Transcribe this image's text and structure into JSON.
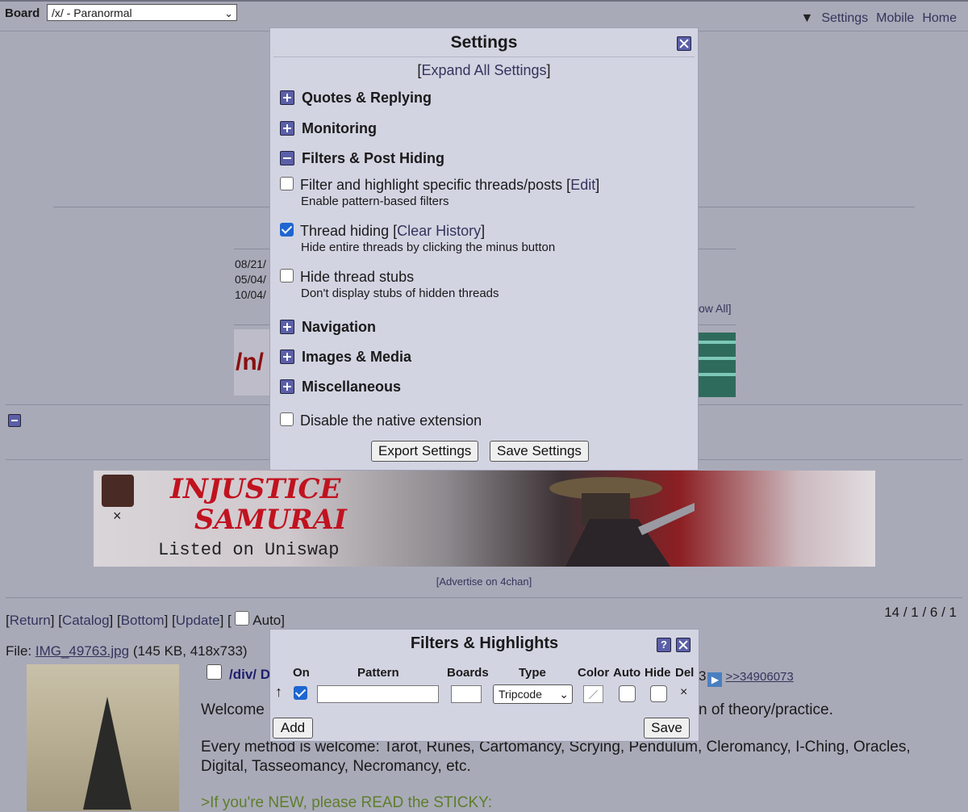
{
  "topbar": {
    "board_label": "Board",
    "board_value": "/x/ - Paranormal",
    "settings_arrow": "▼",
    "settings": "Settings",
    "mobile": "Mobile",
    "home": "Home"
  },
  "background": {
    "dates": [
      "08/21/",
      "05/04/",
      "10/04/"
    ],
    "show_all": "ow All]",
    "banner_text": "/n/"
  },
  "ad": {
    "title_line1": "INJUSTICE",
    "title_line2": "SAMURAI",
    "subtitle": "Listed on Uniswap",
    "close": "×",
    "advertise": "[Advertise on 4chan]"
  },
  "thread": {
    "nav": {
      "return": "Return",
      "catalog": "Catalog",
      "bottom": "Bottom",
      "update": "Update",
      "auto": "Auto"
    },
    "stats": "14 / 1 / 6 / 1",
    "file_prefix": "File: ",
    "file_name": "IMG_49763.jpg",
    "file_info": " (145 KB, 418x733)",
    "post_name": "/div/ D",
    "post_num_tail": "3",
    "post_quote": ">>34906073",
    "welcome": "Welcome",
    "theory": "n of theory/practice.",
    "methods": "Every method is welcome: Tarot, Runes, Cartomancy, Scrying, Pendulum, Cleromancy, I-Ching, Oracles, Digital, Tasseomancy, Necromancy, etc.",
    "greentext": ">If you're NEW, please READ the STICKY:"
  },
  "settings": {
    "title": "Settings",
    "expand_all": "Expand All Settings",
    "sections": {
      "quotes": "Quotes & Replying",
      "monitoring": "Monitoring",
      "filters": "Filters & Post Hiding",
      "navigation": "Navigation",
      "images": "Images & Media",
      "misc": "Miscellaneous"
    },
    "options": {
      "filter_label": "Filter and highlight specific threads/posts",
      "filter_link": "Edit",
      "filter_desc": "Enable pattern-based filters",
      "filter_checked": false,
      "hiding_label": "Thread hiding",
      "hiding_link": "Clear History",
      "hiding_desc": "Hide entire threads by clicking the minus button",
      "hiding_checked": true,
      "stubs_label": "Hide thread stubs",
      "stubs_desc": "Don't display stubs of hidden threads",
      "stubs_checked": false
    },
    "disable_native": "Disable the native extension",
    "export": "Export Settings",
    "save": "Save Settings"
  },
  "filters": {
    "title": "Filters & Highlights",
    "help": "?",
    "headers": {
      "on": "On",
      "pattern": "Pattern",
      "boards": "Boards",
      "type": "Type",
      "color": "Color",
      "auto": "Auto",
      "hide": "Hide",
      "del": "Del"
    },
    "row": {
      "arrow": "↑",
      "on_checked": true,
      "pattern": "",
      "boards": "",
      "type": "Tripcode",
      "del": "×"
    },
    "add": "Add",
    "save": "Save"
  },
  "colors": {
    "page_bg": "#a9aab8",
    "modal_bg": "#d3d4e2",
    "link": "#34345c",
    "button_accent": "#5b5fa8",
    "checkbox_on": "#1e66d0",
    "greentext": "#5d7e2a"
  }
}
